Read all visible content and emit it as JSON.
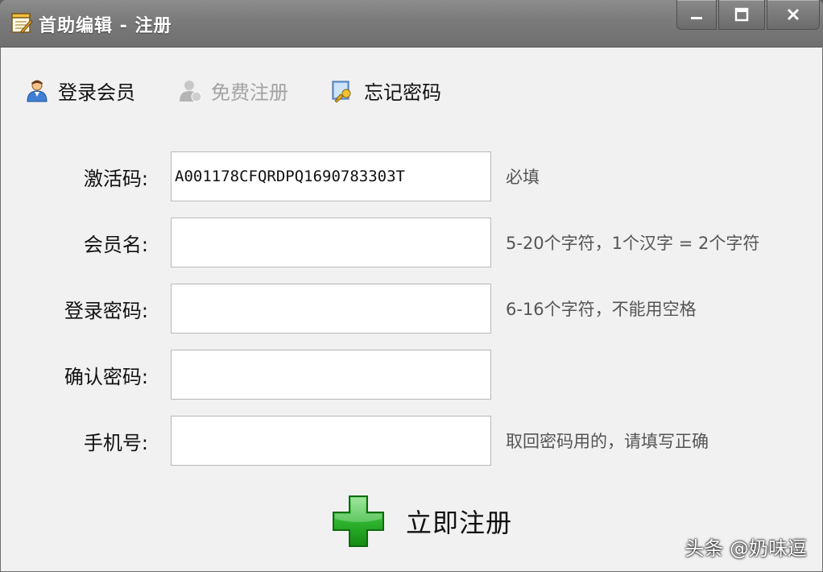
{
  "window": {
    "title": "首助编辑 - 注册"
  },
  "toolbar": {
    "items": [
      {
        "label": "登录会员",
        "icon": "user-icon",
        "enabled": true
      },
      {
        "label": "免费注册",
        "icon": "user-add-icon",
        "enabled": false
      },
      {
        "label": "忘记密码",
        "icon": "key-icon",
        "enabled": true
      }
    ]
  },
  "form": {
    "fields": [
      {
        "label": "激活码:",
        "value": "A001178CFQRDPQ1690783303T",
        "hint": "必填"
      },
      {
        "label": "会员名:",
        "value": "",
        "hint": "5-20个字符，1个汉字 = 2个字符"
      },
      {
        "label": "登录密码:",
        "value": "",
        "hint": "6-16个字符，不能用空格"
      },
      {
        "label": "确认密码:",
        "value": "",
        "hint": ""
      },
      {
        "label": "手机号:",
        "value": "",
        "hint": "取回密码用的，请填写正确"
      }
    ],
    "submit_label": "立即注册"
  },
  "watermark": "头条 @奶味逗",
  "colors": {
    "titlebar": "#7a7a7a",
    "background": "#f1f1f1",
    "submit_icon": "#2aa82a"
  }
}
